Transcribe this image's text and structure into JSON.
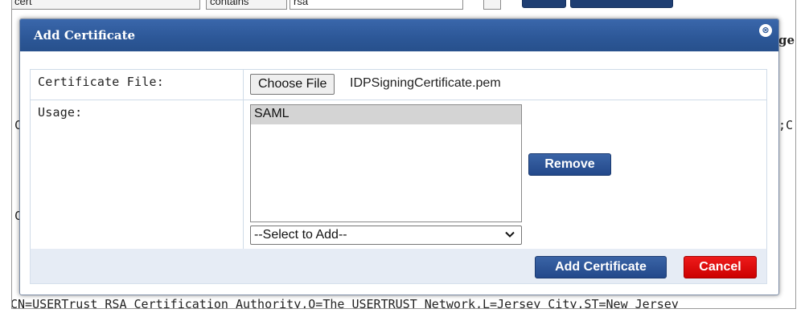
{
  "background": {
    "filter_field": "cert",
    "filter_operator": "contains",
    "filter_value": "rsa",
    "row_fragment_left_1": "C",
    "row_fragment_left_2": "C",
    "row_fragment_right_1": ";C",
    "header_fragment_right": "ge",
    "bottom_row_text": "CN=USERTrust RSA Certification Authority,O=The USERTRUST Network,L=Jersey City,ST=New Jersey"
  },
  "dialog": {
    "title": "Add Certificate",
    "close_glyph": "⊗",
    "fields": {
      "certificate_file_label": "Certificate File:",
      "choose_file_label": "Choose File",
      "file_name": "IDPSigningCertificate.pem",
      "usage_label": "Usage:",
      "usage_items": [
        "SAML"
      ],
      "remove_label": "Remove",
      "select_to_add": "--Select to Add--"
    },
    "footer": {
      "add_certificate_label": "Add Certificate",
      "cancel_label": "Cancel"
    }
  },
  "colors": {
    "header_blue": "#2c5797",
    "button_blue": "#23488a",
    "cancel_red": "#cc0000",
    "footer_bg": "#e6ecf5"
  }
}
